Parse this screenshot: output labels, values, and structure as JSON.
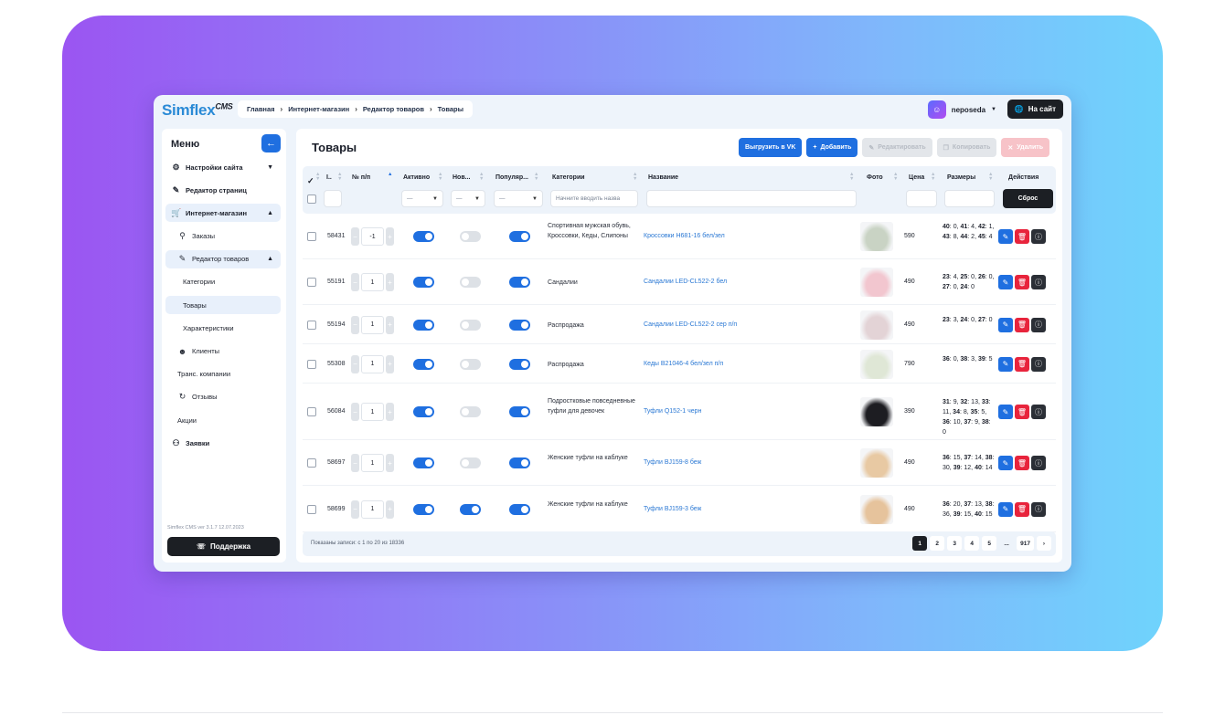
{
  "app": {
    "logo": "Simflex",
    "logo_mark": "CMS",
    "breadcrumbs": [
      "Главная",
      "Интернет-магазин",
      "Редактор товаров",
      "Товары"
    ],
    "user_name": "neposeda",
    "site_button": "На сайт"
  },
  "sidebar": {
    "title": "Меню",
    "items": [
      {
        "label": "Настройки сайта",
        "icon": "gear-icon"
      },
      {
        "label": "Редактор страниц",
        "icon": "edit-icon"
      },
      {
        "label": "Интернет-магазин",
        "icon": "cart-icon"
      },
      {
        "label": "Заказы",
        "icon": "orders-icon"
      },
      {
        "label": "Редактор товаров",
        "icon": "edit-icon"
      },
      {
        "label": "Категории"
      },
      {
        "label": "Товары"
      },
      {
        "label": "Характеристики"
      },
      {
        "label": "Клиенты",
        "icon": "users-icon"
      },
      {
        "label": "Транс. компании"
      },
      {
        "label": "Отзывы",
        "icon": "reviews-icon"
      },
      {
        "label": "Акции"
      },
      {
        "label": "Заявки",
        "icon": "add-user-icon"
      }
    ],
    "version": "Simflex CMS ver 3.1.7 12.07.2023",
    "support": "Поддержка"
  },
  "main": {
    "title": "Товары",
    "buttons": {
      "vk": "Выгрузить в VK",
      "add": "Добавить",
      "edit": "Редактировать",
      "copy": "Копировать",
      "delete": "Удалить"
    },
    "columns": {
      "id": "I..",
      "num": "№ п/п",
      "active": "Активно",
      "new": "Нов...",
      "popular": "Популяр...",
      "categories": "Категории",
      "name": "Название",
      "photo": "Фото",
      "price": "Цена",
      "sizes": "Размеры",
      "actions": "Действия"
    },
    "filters": {
      "active": "—",
      "new": "—",
      "popular": "—",
      "categories_placeholder": "Начните вводить назва",
      "reset": "Сброс"
    },
    "rows": [
      {
        "id": "58431",
        "num": "-1",
        "active": true,
        "new": false,
        "popular": true,
        "category": "Спортивная мужская обувь, Кроссовки, Кеды, Слипоны",
        "name": "Кроссовки H681-16 бел/зел",
        "price": "590",
        "sizes": [
          [
            "40",
            "0"
          ],
          [
            "41",
            "4"
          ],
          [
            "42",
            "1"
          ],
          [
            "43",
            "8"
          ],
          [
            "44",
            "2"
          ],
          [
            "45",
            "4"
          ]
        ],
        "photo_color": "#c9d3c4"
      },
      {
        "id": "55191",
        "num": "1",
        "active": true,
        "new": false,
        "popular": true,
        "category": "Сандалии",
        "name": "Сандалии LED-CL522-2 бел",
        "price": "490",
        "sizes": [
          [
            "23",
            "4"
          ],
          [
            "25",
            "0"
          ],
          [
            "26",
            "0"
          ],
          [
            "27",
            "0"
          ],
          [
            "24",
            "0"
          ]
        ],
        "photo_color": "#f2c6cf"
      },
      {
        "id": "55194",
        "num": "1",
        "active": true,
        "new": false,
        "popular": true,
        "category": "Распродажа",
        "name": "Сандалии LED-CL522-2 сер п/п",
        "price": "490",
        "sizes": [
          [
            "23",
            "3"
          ],
          [
            "24",
            "0"
          ],
          [
            "27",
            "0"
          ]
        ],
        "photo_color": "#e3d3d6"
      },
      {
        "id": "55308",
        "num": "1",
        "active": true,
        "new": false,
        "popular": true,
        "category": "Распродажа",
        "name": "Кеды B21046-4 бел/зел п/п",
        "price": "790",
        "sizes": [
          [
            "36",
            "0"
          ],
          [
            "38",
            "3"
          ],
          [
            "39",
            "5"
          ]
        ],
        "photo_color": "#dfe7d6"
      },
      {
        "id": "56084",
        "num": "1",
        "active": true,
        "new": false,
        "popular": true,
        "category": "Подростковые повседневные туфли для девочек",
        "name": "Туфли Q152-1 черн",
        "price": "390",
        "sizes": [
          [
            "31",
            "9"
          ],
          [
            "32",
            "13"
          ],
          [
            "33",
            "11"
          ],
          [
            "34",
            "8"
          ],
          [
            "35",
            "5"
          ],
          [
            "36",
            "10"
          ],
          [
            "37",
            "9"
          ],
          [
            "38",
            "0"
          ]
        ],
        "photo_color": "#1d1d22"
      },
      {
        "id": "58697",
        "num": "1",
        "active": true,
        "new": false,
        "popular": true,
        "category": "Женские туфли на каблуке",
        "name": "Туфли BJ159-8 беж",
        "price": "490",
        "sizes": [
          [
            "36",
            "15"
          ],
          [
            "37",
            "14"
          ],
          [
            "38",
            "30"
          ],
          [
            "39",
            "12"
          ],
          [
            "40",
            "14"
          ]
        ],
        "photo_color": "#e8c9a3"
      },
      {
        "id": "58699",
        "num": "1",
        "active": true,
        "new": true,
        "popular": true,
        "category": "Женские туфли на каблуке",
        "name": "Туфли BJ159-3 беж",
        "price": "490",
        "sizes": [
          [
            "36",
            "20"
          ],
          [
            "37",
            "13"
          ],
          [
            "38",
            "36"
          ],
          [
            "39",
            "15"
          ],
          [
            "40",
            "15"
          ]
        ],
        "photo_color": "#e6c39c"
      }
    ],
    "footer": {
      "shown": "Показаны записи: с 1 по 20 из 18336",
      "pages": [
        "1",
        "2",
        "3",
        "4",
        "5",
        "...",
        "917",
        "›"
      ]
    }
  }
}
